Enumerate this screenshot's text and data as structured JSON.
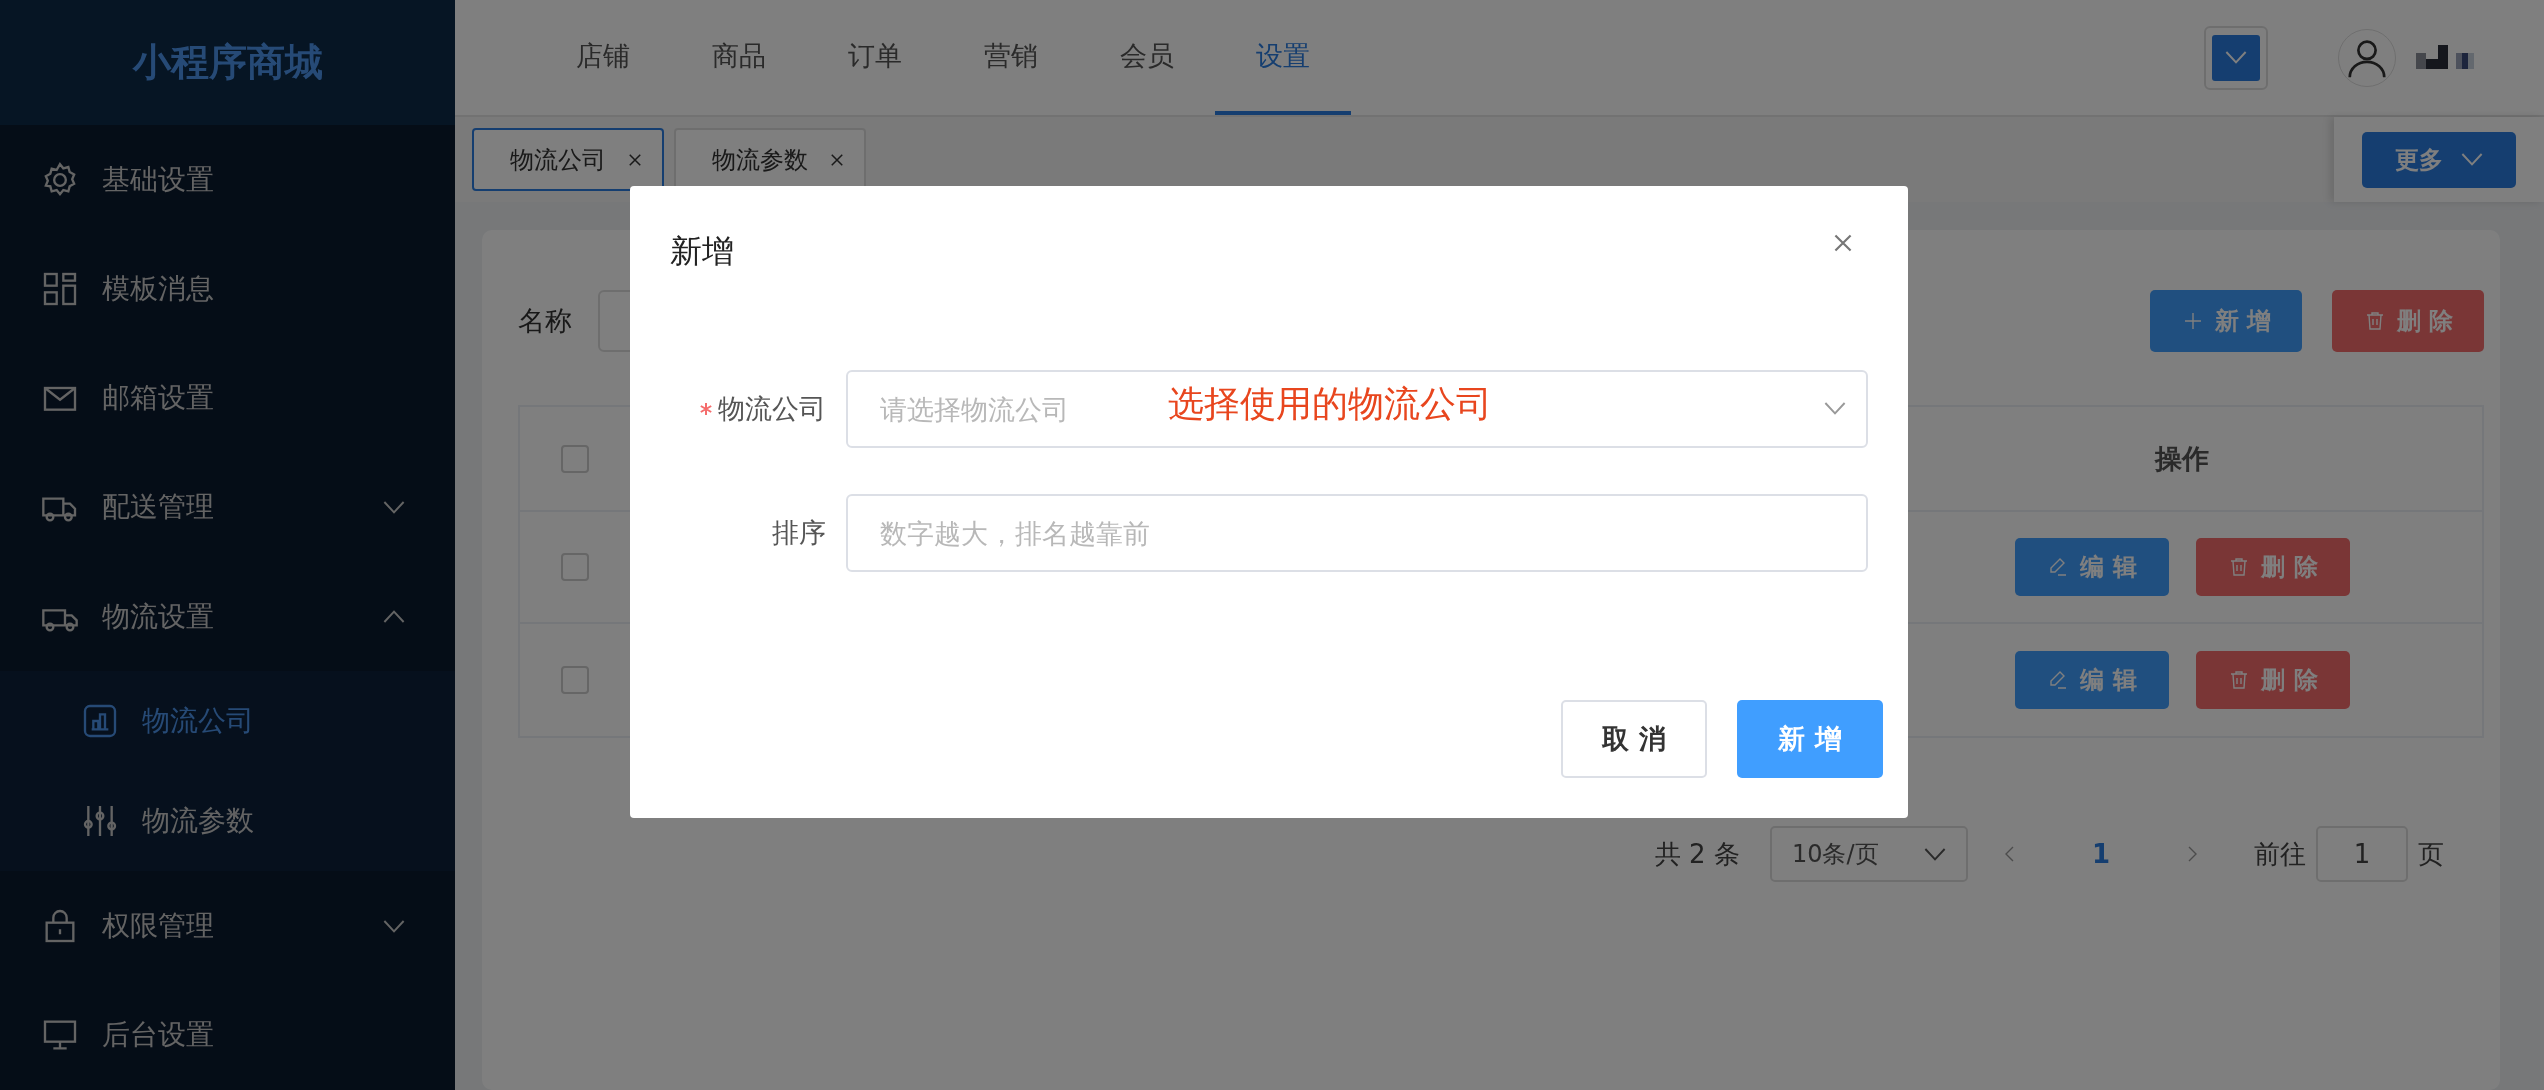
{
  "sidebar": {
    "logo": "小程序商城",
    "items": [
      {
        "kind": "link",
        "label": "基础设置",
        "selected": false
      },
      {
        "kind": "link",
        "label": "模板消息",
        "selected": false
      },
      {
        "kind": "link",
        "label": "邮箱设置",
        "selected": false
      },
      {
        "kind": "group",
        "label": "配送管理",
        "expanded": false
      },
      {
        "kind": "group",
        "label": "物流设置",
        "expanded": true,
        "children": [
          {
            "label": "物流公司",
            "selected": true
          },
          {
            "label": "物流参数",
            "selected": false
          }
        ]
      },
      {
        "kind": "group",
        "label": "权限管理",
        "expanded": false
      },
      {
        "kind": "link",
        "label": "后台设置",
        "selected": false
      }
    ]
  },
  "top_nav": {
    "tabs": [
      {
        "label": "店铺",
        "selected": false
      },
      {
        "label": "商品",
        "selected": false
      },
      {
        "label": "订单",
        "selected": false
      },
      {
        "label": "营销",
        "selected": false
      },
      {
        "label": "会员",
        "selected": false
      },
      {
        "label": "设置",
        "selected": true
      }
    ]
  },
  "tag_bar": {
    "tags": [
      {
        "label": "物流公司",
        "selected": true
      },
      {
        "label": "物流参数",
        "selected": false
      }
    ],
    "more_button": "更多"
  },
  "filter": {
    "label": "名称"
  },
  "toolbar": [
    {
      "label": "新 增",
      "kind": "primary"
    },
    {
      "label": "删 除",
      "kind": "danger"
    }
  ],
  "table": {
    "header_checked": false,
    "columns": [
      "操作"
    ],
    "rows": [
      {
        "checked": false,
        "actions": [
          {
            "label": "编 辑",
            "kind": "primary"
          },
          {
            "label": "删 除",
            "kind": "danger"
          }
        ]
      },
      {
        "checked": false,
        "actions": [
          {
            "label": "编 辑",
            "kind": "primary"
          },
          {
            "label": "删 除",
            "kind": "danger"
          }
        ]
      }
    ]
  },
  "pagination": {
    "total": "共 2 条",
    "page_size": "10条/页",
    "pages": [
      {
        "label": "1",
        "selected": true
      }
    ],
    "goto_label": "前往",
    "goto_value": "1",
    "goto_suffix": "页"
  },
  "dialog": {
    "title": "新增",
    "fields": [
      {
        "kind": "select",
        "label": "物流公司",
        "required": true,
        "placeholder": "请选择物流公司"
      },
      {
        "kind": "input",
        "label": "排序",
        "required": false,
        "placeholder": "数字越大，排名越靠前"
      }
    ],
    "annotation": "选择使用的物流公司",
    "buttons": [
      {
        "label": "取 消",
        "kind": "default"
      },
      {
        "label": "新 增",
        "kind": "primary"
      }
    ]
  }
}
